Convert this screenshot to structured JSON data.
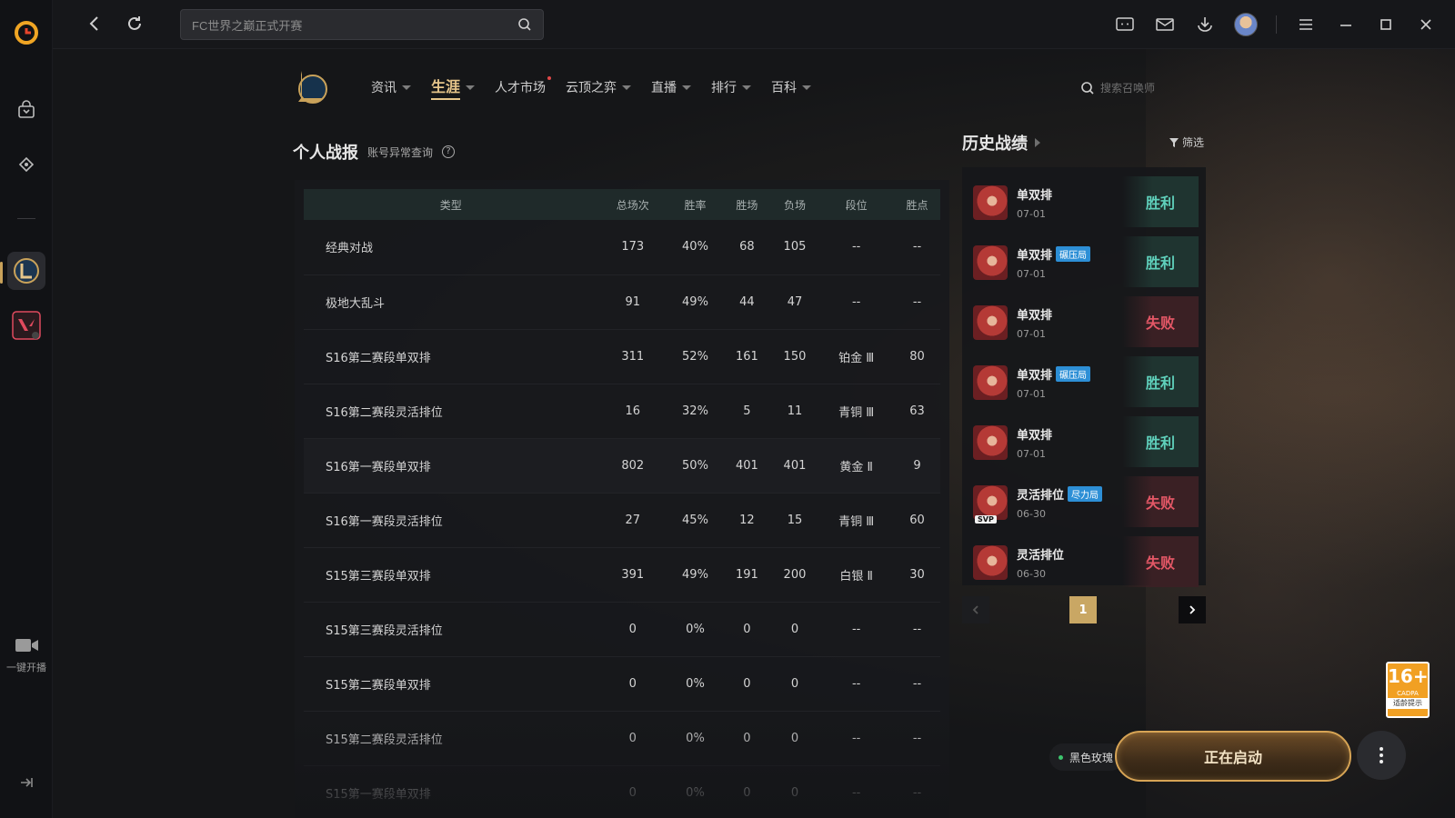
{
  "topbar": {
    "search_placeholder": "FC世界之巅正式开赛"
  },
  "rail": {
    "live_label": "一键开播"
  },
  "game_nav": {
    "items": [
      {
        "label": "资讯",
        "caret": true
      },
      {
        "label": "生涯",
        "caret": true,
        "active": true
      },
      {
        "label": "人才市场",
        "caret": false,
        "dot": true
      },
      {
        "label": "云顶之弈",
        "caret": true
      },
      {
        "label": "直播",
        "caret": true
      },
      {
        "label": "排行",
        "caret": true
      },
      {
        "label": "百科",
        "caret": true
      }
    ],
    "summoner_search_placeholder": "搜索召唤师"
  },
  "personal": {
    "title": "个人战报",
    "account_check": "账号异常查询",
    "help": "?",
    "columns": [
      "类型",
      "总场次",
      "胜率",
      "胜场",
      "负场",
      "段位",
      "胜点"
    ],
    "rows": [
      [
        "经典对战",
        "173",
        "40%",
        "68",
        "105",
        "--",
        "--"
      ],
      [
        "极地大乱斗",
        "91",
        "49%",
        "44",
        "47",
        "--",
        "--"
      ],
      [
        "S16第二赛段单双排",
        "311",
        "52%",
        "161",
        "150",
        "铂金 Ⅲ",
        "80"
      ],
      [
        "S16第二赛段灵活排位",
        "16",
        "32%",
        "5",
        "11",
        "青铜 Ⅲ",
        "63"
      ],
      [
        "S16第一赛段单双排",
        "802",
        "50%",
        "401",
        "401",
        "黄金 Ⅱ",
        "9"
      ],
      [
        "S16第一赛段灵活排位",
        "27",
        "45%",
        "12",
        "15",
        "青铜 Ⅲ",
        "60"
      ],
      [
        "S15第三赛段单双排",
        "391",
        "49%",
        "191",
        "200",
        "白银 Ⅱ",
        "30"
      ],
      [
        "S15第三赛段灵活排位",
        "0",
        "0%",
        "0",
        "0",
        "--",
        "--"
      ],
      [
        "S15第二赛段单双排",
        "0",
        "0%",
        "0",
        "0",
        "--",
        "--"
      ],
      [
        "S15第二赛段灵活排位",
        "0",
        "0%",
        "0",
        "0",
        "--",
        "--"
      ],
      [
        "S15第一赛段单双排",
        "0",
        "0%",
        "0",
        "0",
        "--",
        "--"
      ]
    ]
  },
  "history": {
    "title": "历史战绩",
    "filter_label": "筛选",
    "matches": [
      {
        "mode": "单双排",
        "tag": "",
        "date": "07-01",
        "result": "胜利",
        "win": true,
        "svp": false
      },
      {
        "mode": "单双排",
        "tag": "碾压局",
        "date": "07-01",
        "result": "胜利",
        "win": true,
        "svp": false
      },
      {
        "mode": "单双排",
        "tag": "",
        "date": "07-01",
        "result": "失败",
        "win": false,
        "svp": false
      },
      {
        "mode": "单双排",
        "tag": "碾压局",
        "date": "07-01",
        "result": "胜利",
        "win": true,
        "svp": false
      },
      {
        "mode": "单双排",
        "tag": "",
        "date": "07-01",
        "result": "胜利",
        "win": true,
        "svp": false
      },
      {
        "mode": "灵活排位",
        "tag": "尽力局",
        "date": "06-30",
        "result": "失败",
        "win": false,
        "svp": true
      },
      {
        "mode": "灵活排位",
        "tag": "",
        "date": "06-30",
        "result": "失败",
        "win": false,
        "svp": false
      }
    ],
    "svp_label": "SVP",
    "current_page": "1"
  },
  "bottom": {
    "age_rating": "16+",
    "age_org": "CADPA",
    "age_note": "适龄提示",
    "server": "黑色玫瑰",
    "launch_label": "正在启动"
  },
  "colors": {
    "accent_gold": "#e6c58a",
    "win": "#5fd0bb",
    "loss": "#e35766"
  }
}
